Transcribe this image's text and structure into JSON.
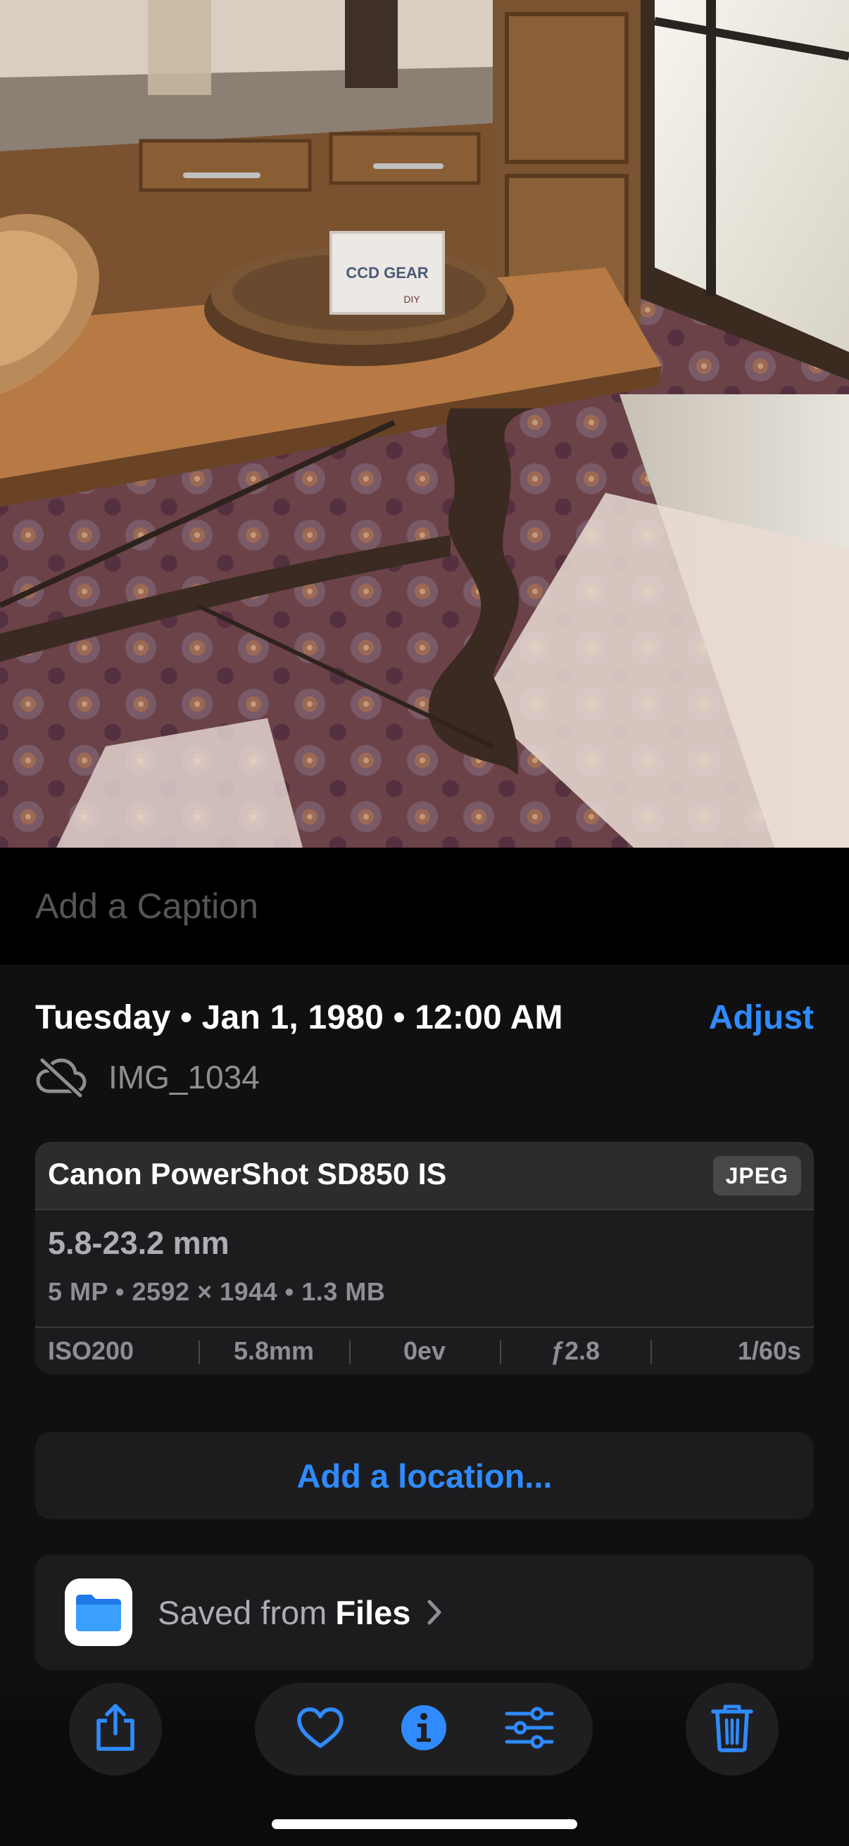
{
  "photo": {
    "sign_lines": [
      "CCD GEAR",
      "DIY"
    ]
  },
  "caption": {
    "placeholder": "Add a Caption"
  },
  "info": {
    "date_time": "Tuesday • Jan 1, 1980 • 12:00 AM",
    "adjust_label": "Adjust",
    "file_name": "IMG_1034",
    "cloud_status_icon": "cloud-slash-icon",
    "camera": {
      "model": "Canon PowerShot SD850 IS",
      "format": "JPEG",
      "lens": "5.8-23.2 mm",
      "specs": "5 MP • 2592 × 1944 • 1.3 MB",
      "exif": [
        "ISO200",
        "5.8mm",
        "0ev",
        "ƒ2.8",
        "1/60s"
      ]
    },
    "location_label": "Add a location...",
    "saved_from": {
      "prefix": "Saved from",
      "app": "Files",
      "icon": "files-app-icon"
    }
  },
  "toolbar": {
    "share_icon": "share-icon",
    "favorite_icon": "heart-icon",
    "info_icon": "info-icon",
    "adjust_icon": "sliders-icon",
    "delete_icon": "trash-icon",
    "accent": "#2f8bff"
  }
}
